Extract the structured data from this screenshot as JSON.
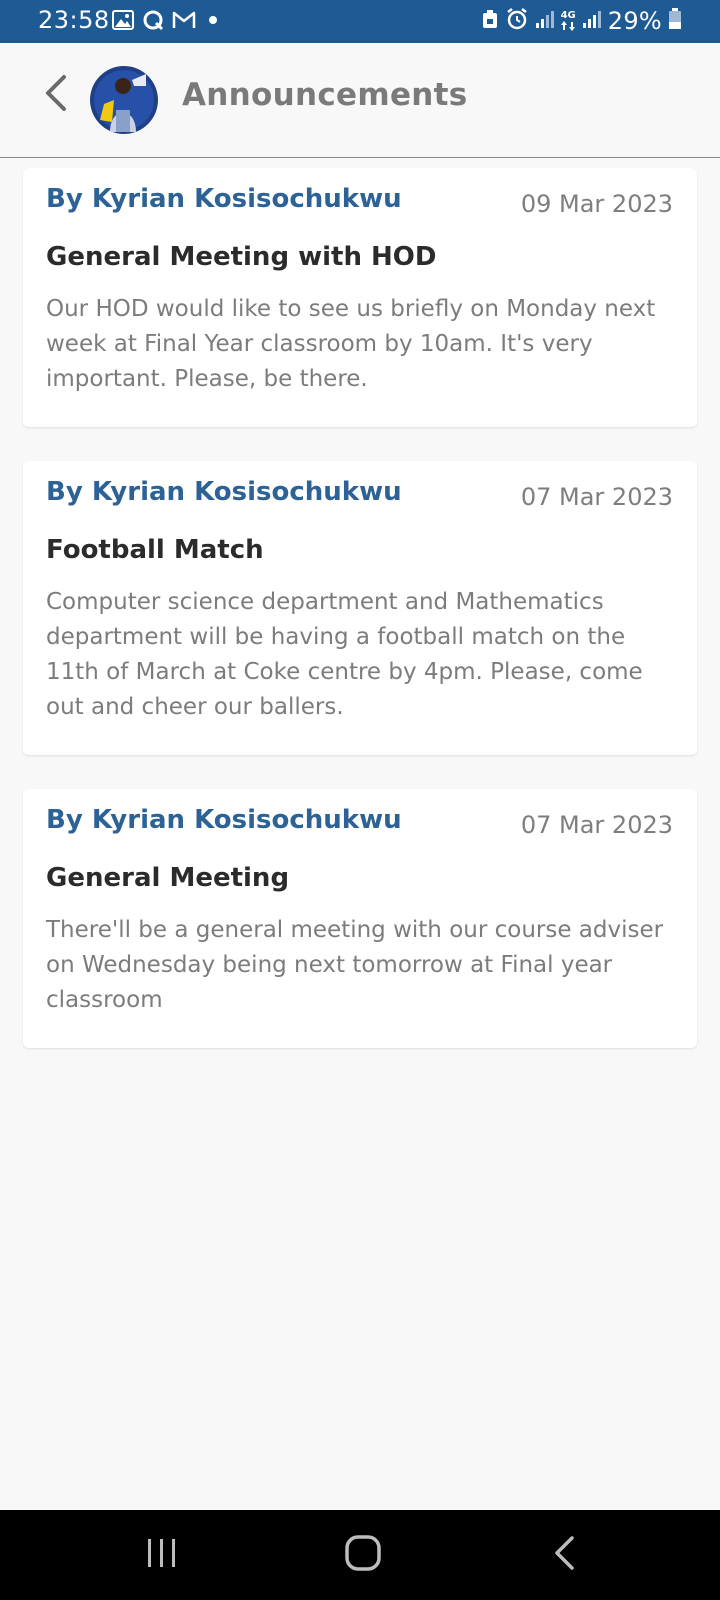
{
  "status_bar": {
    "time": "23:58",
    "battery": "29%",
    "network_label": "4G",
    "left_icons": [
      "gallery-icon",
      "q-app-icon",
      "gmail-icon",
      "notification-dot-icon"
    ],
    "right_icons": [
      "lock-battery-icon",
      "alarm-icon",
      "signal-icon",
      "network-4g-icon",
      "signal-icon",
      "battery-icon"
    ],
    "color": "#1e5a94"
  },
  "header": {
    "title": "Announcements",
    "back_icon": "chevron-left-icon",
    "avatar": "avatar"
  },
  "announcements": [
    {
      "author": "By Kyrian Kosisochukwu",
      "date": "09 Mar 2023",
      "title": "General Meeting with HOD",
      "body": "Our HOD would like to see us briefly on Monday next week at Final Year classroom by 10am. It's very important. Please, be there."
    },
    {
      "author": "By Kyrian Kosisochukwu",
      "date": "07 Mar 2023",
      "title": "Football Match",
      "body": "Computer science department and Mathematics department will be having a football match on the 11th of March at Coke centre by 4pm. Please, come out and cheer our ballers."
    },
    {
      "author": "By Kyrian Kosisochukwu",
      "date": "07 Mar 2023",
      "title": "General Meeting",
      "body": "There'll be a general meeting with our course adviser on Wednesday being next tomorrow at Final year classroom"
    }
  ],
  "nav_bar": {
    "buttons": [
      "recent-apps-icon",
      "home-icon",
      "back-icon"
    ]
  },
  "colors": {
    "accent": "#2c6296",
    "status_bar": "#1e5a94",
    "title_text": "#2b2b2b",
    "body_text": "#7c7c7c",
    "background": "#f8f8f8"
  }
}
